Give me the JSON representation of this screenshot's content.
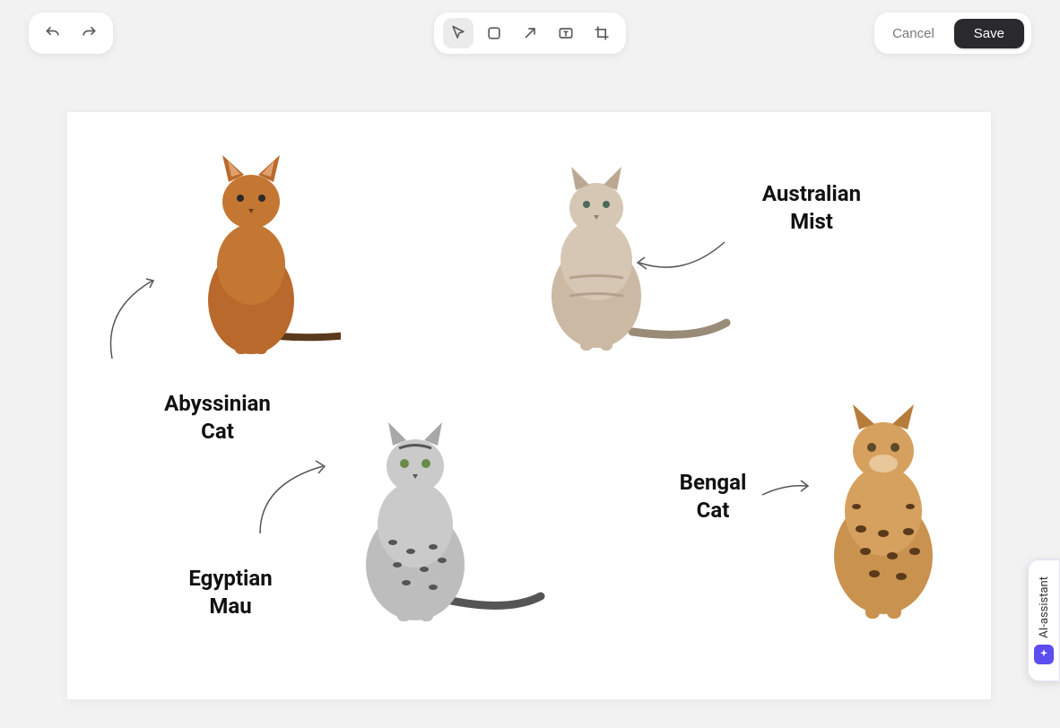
{
  "toolbar": {
    "undo_icon": "undo-icon",
    "redo_icon": "redo-icon",
    "tools": [
      {
        "name": "select-tool",
        "active": true
      },
      {
        "name": "shape-tool",
        "active": false
      },
      {
        "name": "arrow-tool",
        "active": false
      },
      {
        "name": "text-tool",
        "active": false
      },
      {
        "name": "crop-tool",
        "active": false
      }
    ],
    "cancel_label": "Cancel",
    "save_label": "Save"
  },
  "canvas": {
    "labels": {
      "abyssinian": "Abyssinian\nCat",
      "australian_mist": "Australian\nMist",
      "egyptian_mau": "Egyptian\nMau",
      "bengal": "Bengal\nCat"
    },
    "images": {
      "abyssinian": "abyssinian-cat-image",
      "australian_mist": "australian-mist-cat-image",
      "egyptian_mau": "egyptian-mau-cat-image",
      "bengal": "bengal-cat-image"
    }
  },
  "ai_assistant": {
    "label": "AI-assistant"
  }
}
